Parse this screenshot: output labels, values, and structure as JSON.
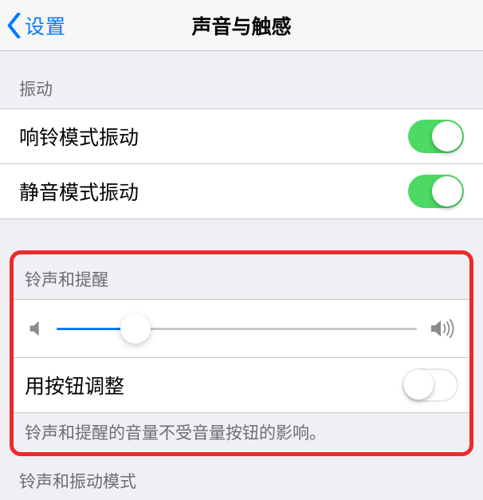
{
  "header": {
    "back_label": "设置",
    "title": "声音与触感"
  },
  "vibrate_section": {
    "header": "振动",
    "ring_vibrate_label": "响铃模式振动",
    "ring_vibrate_on": true,
    "silent_vibrate_label": "静音模式振动",
    "silent_vibrate_on": true
  },
  "ringtone_section": {
    "header": "铃声和提醒",
    "volume_percent": 22,
    "button_adjust_label": "用按钮调整",
    "button_adjust_on": false,
    "footer_text": "铃声和提醒的音量不受音量按钮的影响。"
  },
  "modes_section": {
    "header": "铃声和振动模式"
  }
}
